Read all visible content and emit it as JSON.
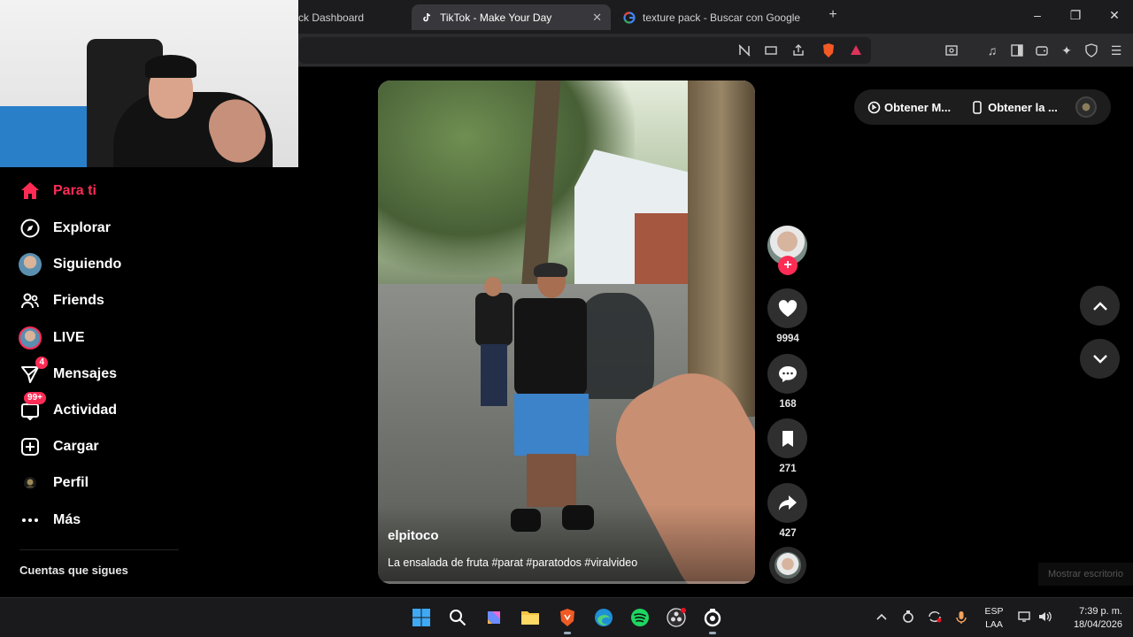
{
  "browser": {
    "tabs": [
      {
        "title": "ck Dashboard",
        "active": false
      },
      {
        "title": "TikTok - Make Your Day",
        "active": true
      },
      {
        "title": "texture pack - Buscar con Google",
        "active": false
      }
    ],
    "new_tab": "+",
    "window_controls": {
      "minimize": "–",
      "maximize": "❐",
      "close": "✕"
    }
  },
  "sidebar": {
    "items": [
      {
        "label": "Para ti",
        "icon": "home-icon"
      },
      {
        "label": "Explorar",
        "icon": "compass-icon"
      },
      {
        "label": "Siguiendo",
        "icon": "avatar"
      },
      {
        "label": "Friends",
        "icon": "friends-icon"
      },
      {
        "label": "LIVE",
        "icon": "avatar"
      },
      {
        "label": "Mensajes",
        "icon": "send-icon",
        "badge": "4"
      },
      {
        "label": "Actividad",
        "icon": "inbox-icon",
        "badge": "99+"
      },
      {
        "label": "Cargar",
        "icon": "upload-icon"
      },
      {
        "label": "Perfil",
        "icon": "profile-avatar"
      },
      {
        "label": "Más",
        "icon": "more-icon"
      }
    ],
    "following_title": "Cuentas que sigues"
  },
  "video": {
    "author": "elpitoco",
    "caption": "La ensalada de fruta #parat #paratodos #viralvideo"
  },
  "actions": {
    "follow": "+",
    "likes": "9994",
    "comments": "168",
    "saves": "271",
    "shares": "427"
  },
  "promo": {
    "item1": "Obtener M...",
    "item2": "Obtener la ..."
  },
  "desktop_hint": "Mostrar escritorio",
  "taskbar": {
    "lang_line1": "ESP",
    "lang_line2": "LAA",
    "time": "7:39 p. m.",
    "date": "18/04/2026"
  },
  "colors": {
    "accent": "#fe2c55",
    "background": "#000000",
    "action_button": "#2f2f2f"
  }
}
